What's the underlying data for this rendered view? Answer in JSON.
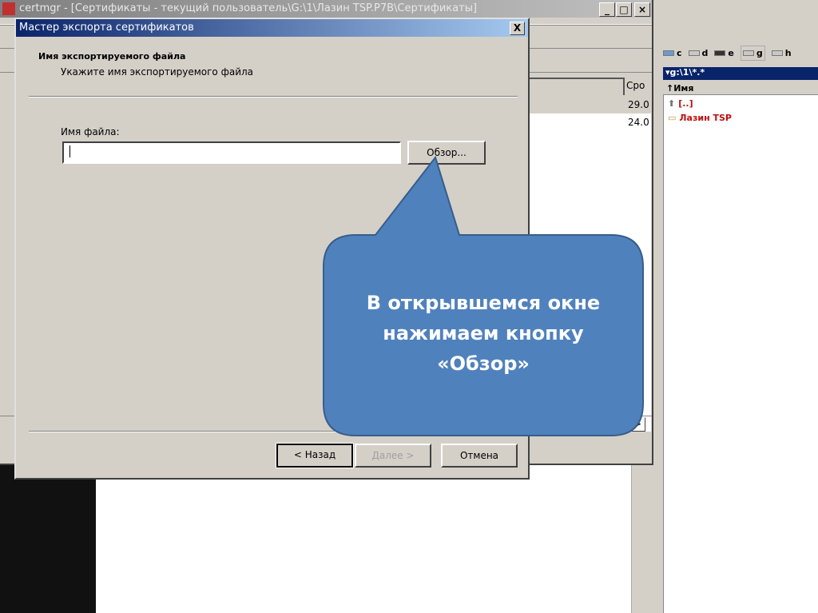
{
  "background_window": {
    "title": "certmgr - [Сертификаты - текущий пользователь\\G:\\1\\Лазин TSP.P7B\\Сертификаты]",
    "column_header": "Сро",
    "dates": [
      "29.0",
      "24.0"
    ]
  },
  "file_manager": {
    "drives": [
      "c",
      "d",
      "e",
      "g",
      "h"
    ],
    "path": "▾g:\\1\\*.*",
    "column_header": "↑Имя",
    "items": [
      "[..]",
      "Лазин TSP"
    ]
  },
  "dialog": {
    "title": "Мастер экспорта сертификатов",
    "section_title": "Имя экспортируемого файла",
    "section_subtitle": "Укажите имя экспортируемого файла",
    "filename_label": "Имя файла:",
    "filename_value": "",
    "browse_label": "Обзор...",
    "back_label": "< Назад",
    "next_label": "Далее >",
    "cancel_label": "Отмена",
    "close_glyph": "X"
  },
  "callout": {
    "text": "В открывшемся окне нажимаем кнопку «Обзор»",
    "lines": [
      "В открывшемся окне",
      "нажимаем кнопку",
      "«Обзор»"
    ],
    "color": "#4f81bd"
  }
}
